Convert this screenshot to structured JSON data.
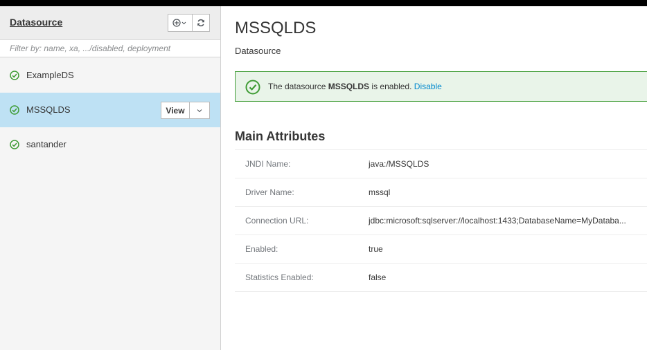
{
  "sidebar": {
    "title": "Datasource",
    "filter_placeholder": "Filter by: name, xa, .../disabled, deployment",
    "items": [
      {
        "label": "ExampleDS",
        "status": "enabled",
        "selected": false
      },
      {
        "label": "MSSQLDS",
        "status": "enabled",
        "selected": true
      },
      {
        "label": "santander",
        "status": "enabled",
        "selected": false
      }
    ],
    "view_label": "View"
  },
  "main": {
    "title": "MSSQLDS",
    "subtitle": "Datasource",
    "alert": {
      "prefix": "The datasource ",
      "name": "MSSQLDS",
      "suffix": " is enabled. ",
      "action": "Disable"
    },
    "section_title": "Main Attributes",
    "attributes": [
      {
        "key": "JNDI Name:",
        "value": "java:/MSSQLDS"
      },
      {
        "key": "Driver Name:",
        "value": "mssql"
      },
      {
        "key": "Connection URL:",
        "value": "jdbc:microsoft:sqlserver://localhost:1433;DatabaseName=MyDataba..."
      },
      {
        "key": "Enabled:",
        "value": "true"
      },
      {
        "key": "Statistics Enabled:",
        "value": "false"
      }
    ]
  },
  "colors": {
    "selected_bg": "#bee1f4",
    "success": "#3f9c35",
    "link": "#0088ce"
  }
}
